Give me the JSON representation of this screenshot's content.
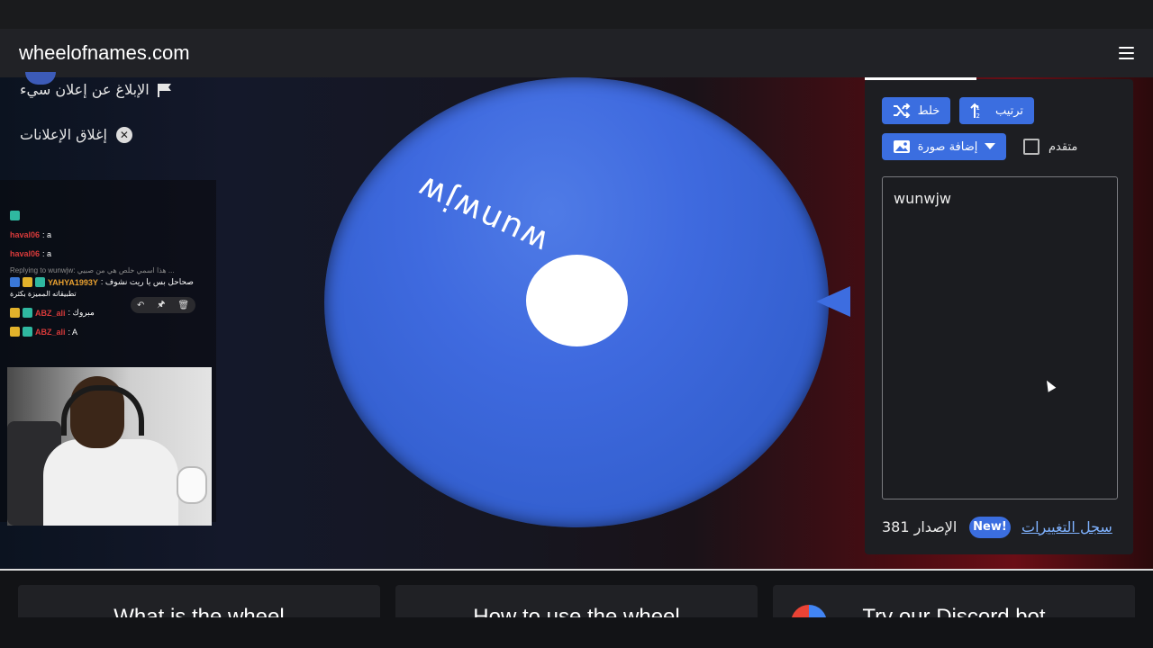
{
  "navbar": {
    "brand": "wheelofnames.com",
    "menu_icon": "hamburger-icon"
  },
  "ads": {
    "report_label": "الإبلاغ عن إعلان سيء",
    "close_label": "إغلاق الإعلانات",
    "report_icon": "flag-icon",
    "close_icon": "close-circle-icon"
  },
  "chat": {
    "messages": [
      {
        "user": "haval06",
        "text": ": a"
      },
      {
        "user": "haval06",
        "text": ": a"
      },
      {
        "reply": "Replying to wunwjw: هذا اسمي خلص هي من صبيي ..."
      },
      {
        "user": "YAHYA1993Y",
        "text": ": صحاحل بس يا ريت نشوف",
        "line2": "تطبيقاته المميزة بكثرة"
      },
      {
        "user": "ABZ_ali",
        "text": ": مبروك"
      },
      {
        "user": "ABZ_ali",
        "text": ": A"
      }
    ],
    "tools": [
      "↶",
      "🖈",
      "🗑"
    ]
  },
  "wheel": {
    "segment_label": "wunwjw",
    "color": "#3f6adf"
  },
  "panel": {
    "shuffle_label": "خلط",
    "sort_label": "ترتيب",
    "add_image_label": "إضافة صورة",
    "advanced_label": "متقدم",
    "entries_text": "wunwjw",
    "version_text": "الإصدار 381",
    "new_badge": "New!",
    "changelog_label": "سجل التغييرات"
  },
  "cards": [
    {
      "title": "What is the wheel"
    },
    {
      "title": "How to use the wheel"
    },
    {
      "title": "Try our Discord bot"
    }
  ],
  "colors": {
    "accent": "#3b6ee0",
    "panel_bg": "#1d1e22",
    "navbar_bg": "#212226"
  }
}
